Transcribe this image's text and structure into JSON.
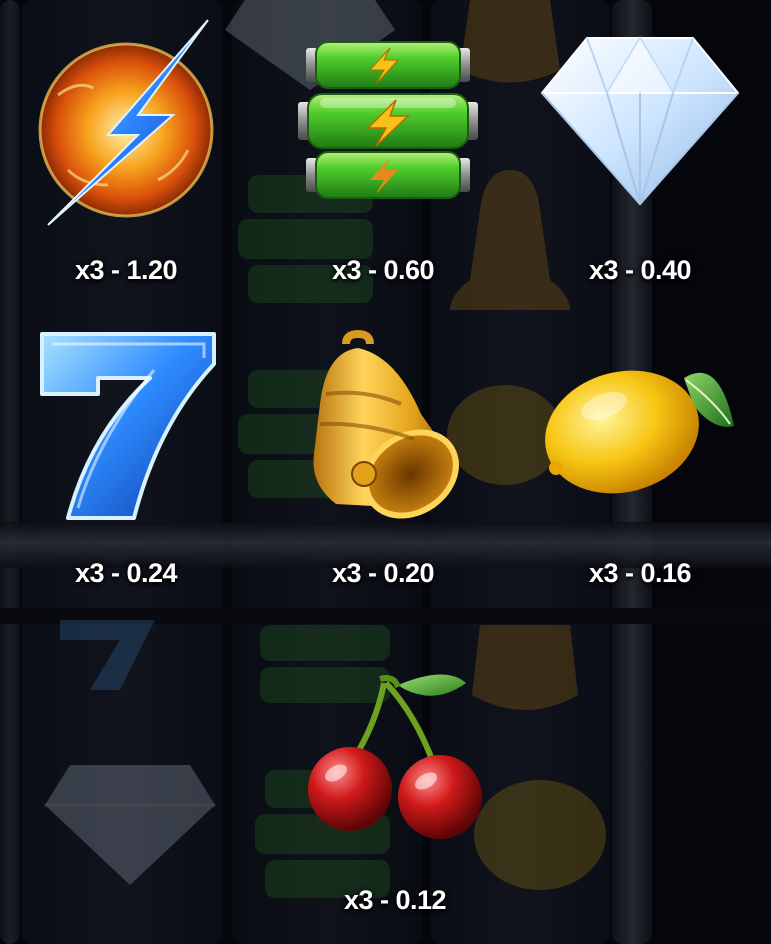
{
  "paytable": {
    "symbols": [
      {
        "id": "lightning",
        "icon": "lightning-orb-icon",
        "payout": "x3 - 1.20"
      },
      {
        "id": "battery",
        "icon": "battery-stack-icon",
        "payout": "x3 - 0.60"
      },
      {
        "id": "diamond",
        "icon": "diamond-icon",
        "payout": "x3 - 0.40"
      },
      {
        "id": "seven",
        "icon": "blue-seven-icon",
        "payout": "x3 - 0.24"
      },
      {
        "id": "bell",
        "icon": "golden-bell-icon",
        "payout": "x3 - 0.20"
      },
      {
        "id": "lemon",
        "icon": "lemon-icon",
        "payout": "x3 - 0.16"
      },
      {
        "id": "cherry",
        "icon": "cherries-icon",
        "payout": "x3 - 0.12"
      }
    ]
  },
  "colors": {
    "background": "#05060c",
    "text": "#ffffff",
    "lightning_orb": "#f59a1a",
    "battery_green": "#3fbf2a",
    "diamond": "#e6f3ff",
    "seven_blue": "#2e8cff",
    "bell_gold": "#e3a21a",
    "lemon_yellow": "#f7c514",
    "cherry_red": "#d01a1a"
  }
}
